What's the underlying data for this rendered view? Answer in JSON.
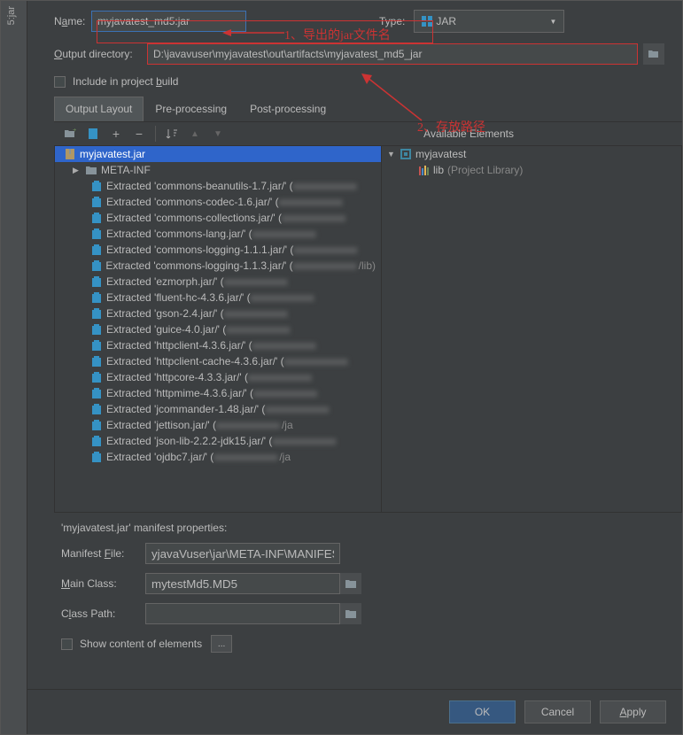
{
  "leftStrip": "5:jar",
  "nameLabel": "Name:",
  "nameValue": "myjavatest_md5:jar",
  "typeLabel": "Type:",
  "typeValue": "JAR",
  "outputLabel": "Output directory:",
  "outputValue": "D:\\javavuser\\myjavatest\\out\\artifacts\\myjavatest_md5_jar",
  "includeBuild": "Include in project build",
  "tabs": {
    "layout": "Output Layout",
    "pre": "Pre-processing",
    "post": "Post-processing"
  },
  "availableLabel": "Available Elements",
  "leftTree": {
    "root": "myjavatest.jar",
    "metaInf": "META-INF",
    "items": [
      "Extracted 'commons-beanutils-1.7.jar/' (",
      "Extracted 'commons-codec-1.6.jar/' (",
      "Extracted 'commons-collections.jar/' (",
      "Extracted 'commons-lang.jar/' (",
      "Extracted 'commons-logging-1.1.1.jar/' (",
      "Extracted 'commons-logging-1.1.3.jar/' (",
      "Extracted 'ezmorph.jar/' (",
      "Extracted 'fluent-hc-4.3.6.jar/' (",
      "Extracted 'gson-2.4.jar/' (",
      "Extracted 'guice-4.0.jar/' (",
      "Extracted 'httpclient-4.3.6.jar/' (",
      "Extracted 'httpclient-cache-4.3.6.jar/' (",
      "Extracted 'httpcore-4.3.3.jar/' (",
      "Extracted 'httpmime-4.3.6.jar/' (",
      "Extracted 'jcommander-1.48.jar/' (",
      "Extracted 'jettison.jar/' (",
      "Extracted 'json-lib-2.2.2-jdk15.jar/' (",
      "Extracted 'ojdbc7.jar/' ("
    ],
    "extraPaths": {
      "5": "/lib)",
      "15": "/ja",
      "17": "/ja"
    }
  },
  "rightTree": {
    "root": "myjavatest",
    "lib": "lib",
    "libSuffix": "(Project Library)"
  },
  "props": {
    "title": "'myjavatest.jar' manifest properties:",
    "manifestLabel": "Manifest File:",
    "manifestValue": "yjavaVuser\\jar\\META-INF\\MANIFEST.MF",
    "mainClassLabel": "Main Class:",
    "mainClassValue": "mytestMd5.MD5",
    "classPathLabel": "Class Path:",
    "classPathValue": ""
  },
  "showContent": "Show content of elements",
  "buttons": {
    "ok": "OK",
    "cancel": "Cancel",
    "apply": "Apply"
  },
  "annotations": {
    "a1": "1、导出的jar文件名",
    "a2": "2、存放路径"
  }
}
